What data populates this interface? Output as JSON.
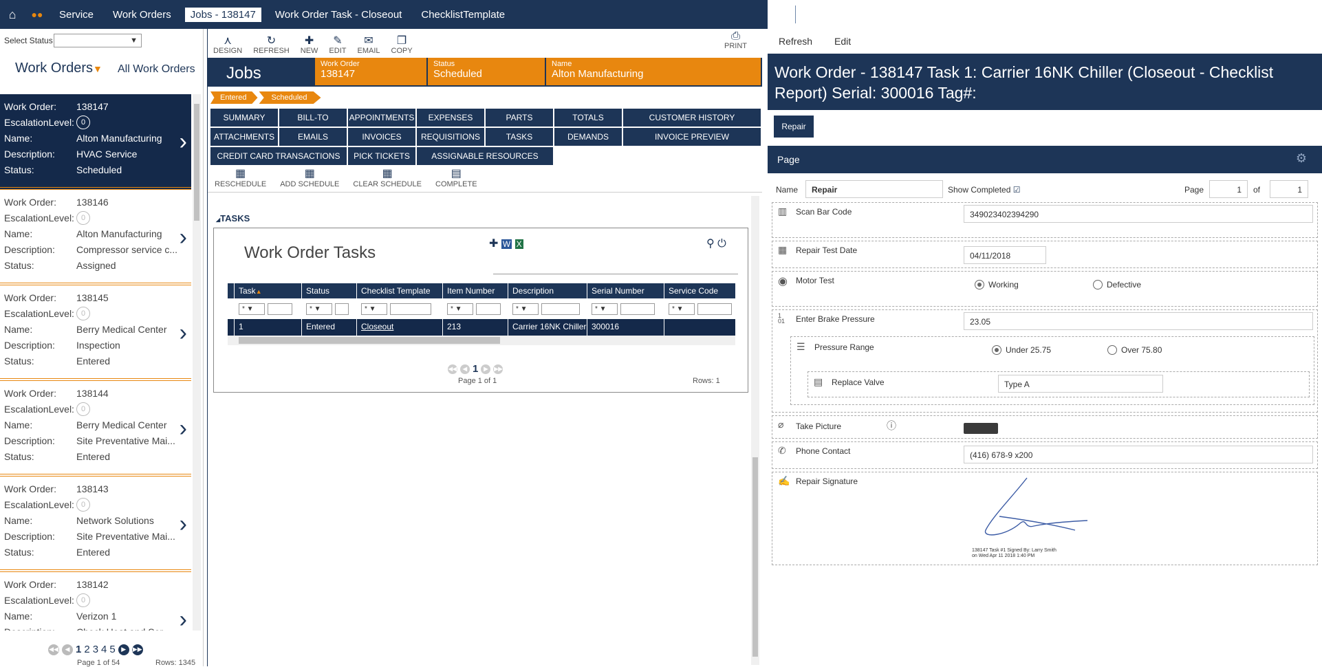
{
  "topbar": {
    "tabs": [
      "Service",
      "Work Orders",
      "Jobs - 138147",
      "Work Order Task - Closeout",
      "ChecklistTemplate"
    ],
    "icons": [
      "home-icon",
      "dots-icon",
      "close-icon",
      "caret-down-icon",
      "add-circle-icon",
      "search-icon",
      "gear-icon"
    ]
  },
  "left": {
    "select_status_label": "Select Status",
    "select_status_value": "",
    "title": "Work Orders",
    "all_label": "All Work Orders",
    "labels": {
      "wo": "Work Order:",
      "esc": "EscalationLevel:",
      "name": "Name:",
      "desc": "Description:",
      "status": "Status:"
    },
    "work_orders": [
      {
        "number": "138147",
        "escalation": "0",
        "name": "Alton Manufacturing",
        "description": "HVAC Service",
        "status": "Scheduled",
        "selected": true
      },
      {
        "number": "138146",
        "escalation": "0",
        "name": "Alton Manufacturing",
        "description": "Compressor service c...",
        "status": "Assigned"
      },
      {
        "number": "138145",
        "escalation": "0",
        "name": "Berry Medical Center",
        "description": "Inspection",
        "status": "Entered"
      },
      {
        "number": "138144",
        "escalation": "0",
        "name": "Berry Medical Center",
        "description": "Site Preventative Mai...",
        "status": "Entered"
      },
      {
        "number": "138143",
        "escalation": "0",
        "name": "Network Solutions",
        "description": "Site Preventative Mai...",
        "status": "Entered"
      },
      {
        "number": "138142",
        "escalation": "0",
        "name": "Verizon 1",
        "description": "Check Heat and Ser...",
        "status": ""
      }
    ],
    "pager": {
      "pages": [
        "1",
        "2",
        "3",
        "4",
        "5"
      ],
      "info": "Page 1 of 54",
      "rows": "Rows: 1345"
    }
  },
  "mid": {
    "toolbar": [
      "DESIGN",
      "REFRESH",
      "NEW",
      "EDIT",
      "EMAIL",
      "COPY"
    ],
    "print": "PRINT",
    "jobs_label": "Jobs",
    "header": [
      {
        "k": "Work Order",
        "v": "138147"
      },
      {
        "k": "Status",
        "v": "Scheduled"
      },
      {
        "k": "Name",
        "v": "Alton Manufacturing"
      }
    ],
    "stages": [
      "Entered",
      "Scheduled"
    ],
    "buttons_row1": [
      "SUMMARY",
      "BILL-TO",
      "APPOINTMENTS",
      "EXPENSES",
      "PARTS",
      "TOTALS",
      "CUSTOMER HISTORY"
    ],
    "buttons_row2": [
      "ATTACHMENTS",
      "EMAILS",
      "INVOICES",
      "REQUISITIONS",
      "TASKS",
      "DEMANDS",
      "INVOICE PREVIEW"
    ],
    "buttons_row3": [
      "CREDIT CARD TRANSACTIONS",
      "PICK TICKETS",
      "ASSIGNABLE RESOURCES"
    ],
    "actions": [
      "RESCHEDULE",
      "ADD SCHEDULE",
      "CLEAR SCHEDULE",
      "COMPLETE"
    ],
    "tasks_label": "TASKS",
    "task_title": "Work Order Tasks",
    "columns": [
      "Task",
      "Status",
      "Checklist Template",
      "Item Number",
      "Description",
      "Serial Number",
      "Service Code"
    ],
    "filter_value": "*",
    "row": [
      "1",
      "Entered",
      "Closeout",
      "213",
      "Carrier 16NK Chiller",
      "300016",
      ""
    ],
    "pager": {
      "page": "1",
      "info": "Page 1 of 1",
      "rows": "Rows: 1"
    }
  },
  "right": {
    "toolbar": [
      "Refresh",
      "Edit"
    ],
    "title": "Work Order - 138147 Task 1: Carrier 16NK Chiller (Closeout - Checklist Report) Serial: 300016 Tag#:",
    "repair_button": "Repair",
    "page_bar": "Page",
    "name_label": "Name",
    "name_value": "Repair",
    "show_completed": "Show Completed",
    "page_label": "Page",
    "page_value": "1",
    "of_label": "of",
    "of_value": "1",
    "fields": {
      "scan": {
        "label": "Scan Bar Code",
        "value": "349023402394290"
      },
      "date": {
        "label": "Repair Test Date",
        "value": "04/11/2018"
      },
      "motor": {
        "label": "Motor Test",
        "opt1": "Working",
        "opt2": "Defective"
      },
      "brake": {
        "label": "Enter Brake Pressure",
        "value": "23.05"
      },
      "range": {
        "label": "Pressure Range",
        "opt1": "Under 25.75",
        "opt2": "Over 75.80"
      },
      "valve": {
        "label": "Replace Valve",
        "value": "Type A"
      },
      "picture": {
        "label": "Take Picture"
      },
      "phone": {
        "label": "Phone Contact",
        "value": "(416) 678-9 x200"
      },
      "signature": {
        "label": "Repair Signature",
        "caption1": "138147 Task #1 Signed By: Larry Smith",
        "caption2": "on Wed Apr 11 2018 1:40 PM"
      }
    }
  }
}
